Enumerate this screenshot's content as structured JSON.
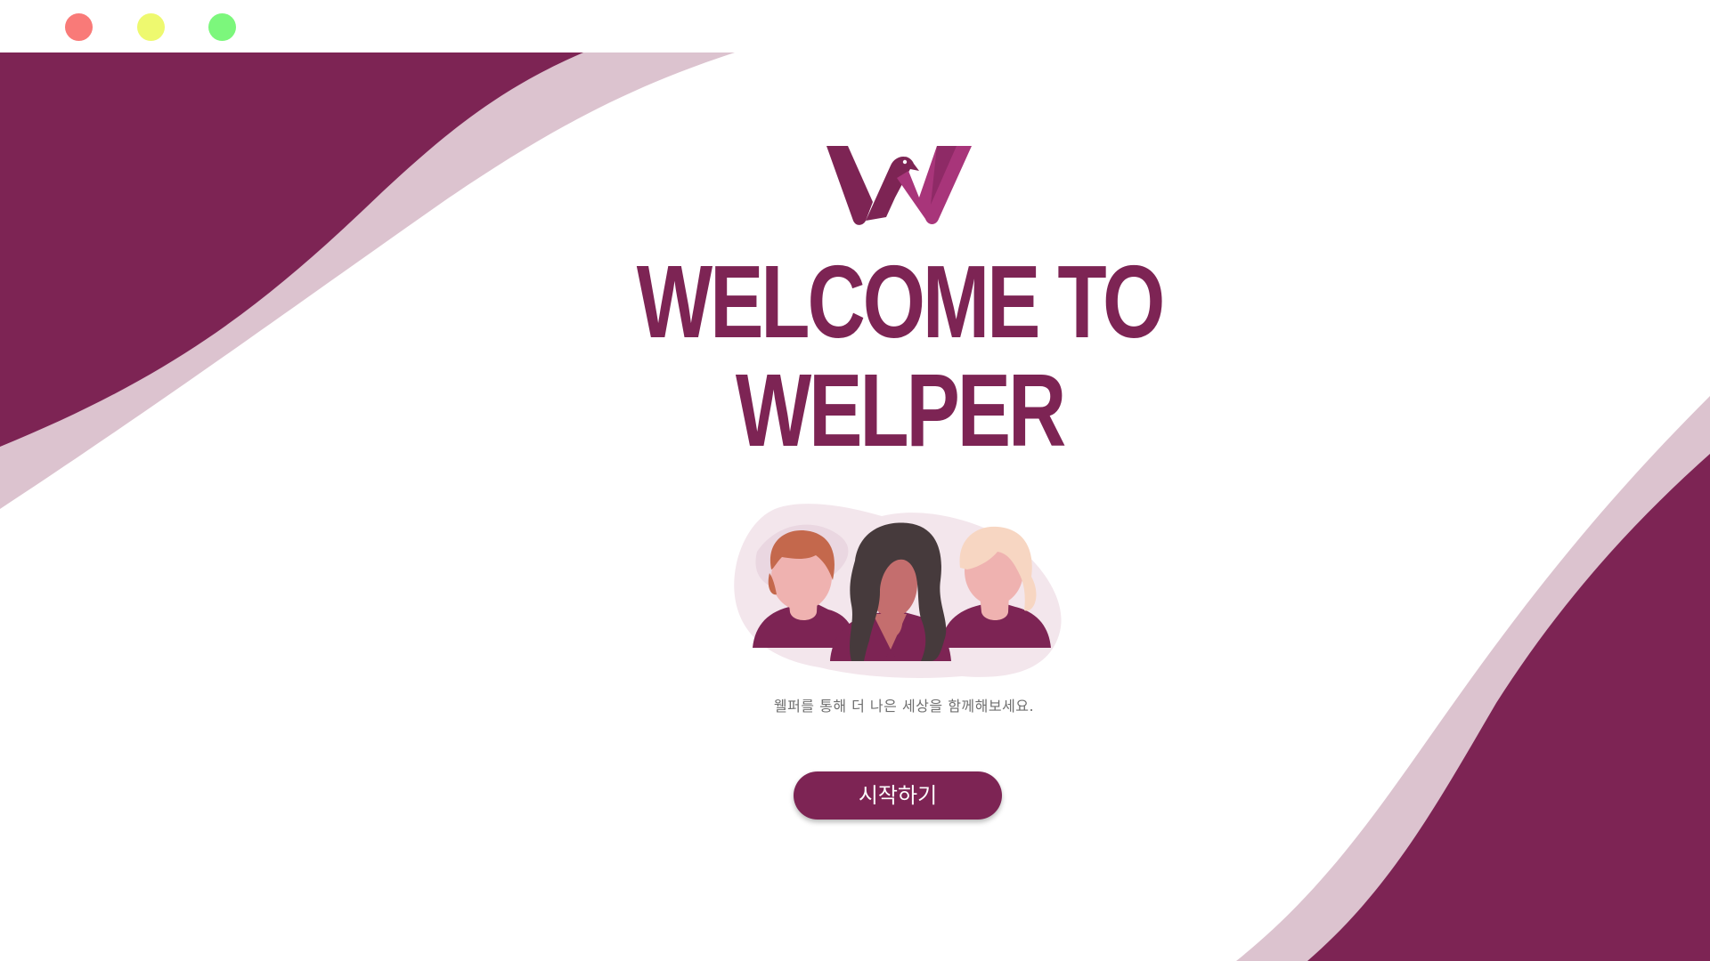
{
  "window": {
    "controls": [
      "close",
      "minimize",
      "maximize"
    ]
  },
  "brand": {
    "logo_icon": "welper-w-bird-logo",
    "primary_color": "#7d2454",
    "accent_color": "#a8357a",
    "wave_light_color": "#dcc3cf"
  },
  "hero": {
    "title_line1": "WELCOME TO",
    "title_line2": "WELPER",
    "illustration": "three-women-illustration",
    "subtitle": "웰퍼를 통해 더 나은 세상을 함께해보세요."
  },
  "actions": {
    "start_label": "시작하기"
  }
}
